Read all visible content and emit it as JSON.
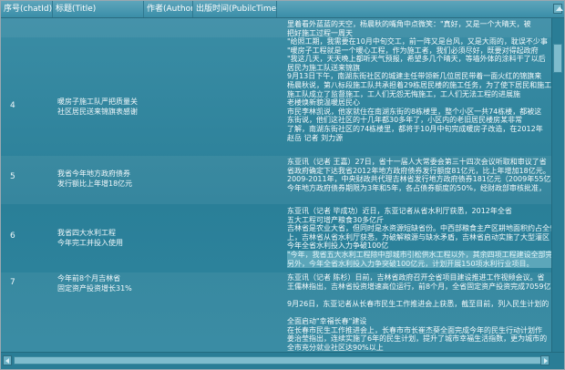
{
  "columns": [
    {
      "label": "序号(chatId)"
    },
    {
      "label": "标题(Title)"
    },
    {
      "label": "作者(Author)"
    },
    {
      "label": "出版时间(PubilcTime)"
    }
  ],
  "rows": [
    {
      "id": "",
      "title": "",
      "content": [
        "里着看外蓝蓝的天空，杨晨秋的嘴角中点微笑：\"真好，又是一个大晴天，被",
        "把好施工过程一周天"
      ]
    },
    {
      "id": "4",
      "title": "暖房子施工队严把质量关\n社区居民送来锦旗表感谢",
      "content": [
        "\"给照工期，我需要在10月中旬交工，前一阵又是台风，又是大雨的，耽误不少事",
        "\"暖房子工程就是一个暖心工程，作为施工者，我们必须尽好，既要对得起政府",
        "\"我这几天，天天晚上都听天气预报，希望多几个晴天，等墙外体的涂料干了以后",
        "居民为施工队送来锦旗",
        "9月13日下午，南湖东街社区的城建主任带领新几位居民带着一面火红的锦旗来",
        "杨晨秋说，第八标段施工队共承担着29栋居民楼的施工任务，为了使下居民和施工",
        "施工队成立了监督施工，工人们无怨无悔施工，工人们无法工程的进展施",
        "老楼焕新貌温暖居民心",
        "市民李林凯说，他家就住在南湖东街的8栋楼里，整个小区一共74栋楼，都被这",
        "东街说，他们这社区的十几年都30多年了，小区内的老旧居民楼房某非常",
        "了解，南湖东街社区的74栋楼里，都将于10月中旬完成暖房子改造，在2012年",
        "赵岳 记者 刘力源"
      ]
    },
    {
      "id": "5",
      "title": "我省今年地方政府债券\n发行额比上年增18亿元",
      "content": [
        "东亚讯（记者 王嘉）27日，省十一届人大常委会第三十四次会议听取和审议了省",
        "省政府确定下达我省2012年地方政府债券发行额度81亿元，比上年增加18亿元。",
        "2009-2011年，中央财政共代理吉林省发行地方政府债券181亿元（2009年55亿元",
        "今年地方政府债券期限为3年和5年，各占债券额度的50%，经财政部审核批准，"
      ]
    },
    {
      "id": "6",
      "title": "我省四大水利工程\n今年完工并投入使用",
      "content": [
        "东亚讯（记者 毕成功）近日，东亚记者从省水利厅获悉，2012年全省",
        "五大工程可增产粮食30多亿斤",
        "吉林省是农业大省，但同时是水资源短缺省份。中西部粮食主产区耕地面积约占全省",
        "上，吉林省从省水利厅获悉，为破解粮源与缺水矛盾，吉林省启动实施了大型灌区",
        "今年全省水利投入力争破100亿",
        "\"今年，我省五大水利工程除中部城市引松供水工程以外，其余四项工程建设全部完",
        "另外，今年全省水利投入力争突破100亿元，计划开展150项水利行业项目。"
      ]
    },
    {
      "id": "7",
      "title": "今年前8个月吉林省\n固定资产投资增长31%",
      "content": [
        "东亚讯（记者 陈杉）日前，吉林省政府召开全省项目建设推进工作视频会议。省",
        "王儒林指出，吉林省投资增速高位运行，前8个月，全省固定资产投资完成7059亿",
        "",
        "9月26日，东亚记者从长春市民生工作推进会上获悉，截至目前，列入民生计划的",
        "",
        "全面启动\"幸福长春\"建设",
        "在长春市民生工作推进会上，长春市市长崔杰葵全面完成今年的民生行动计划作",
        "姜治莹指出，连续实施了6年的民生计划，提升了城市幸福生活指数，更为城市的",
        "全市充分就业社区达90%以上"
      ]
    }
  ]
}
